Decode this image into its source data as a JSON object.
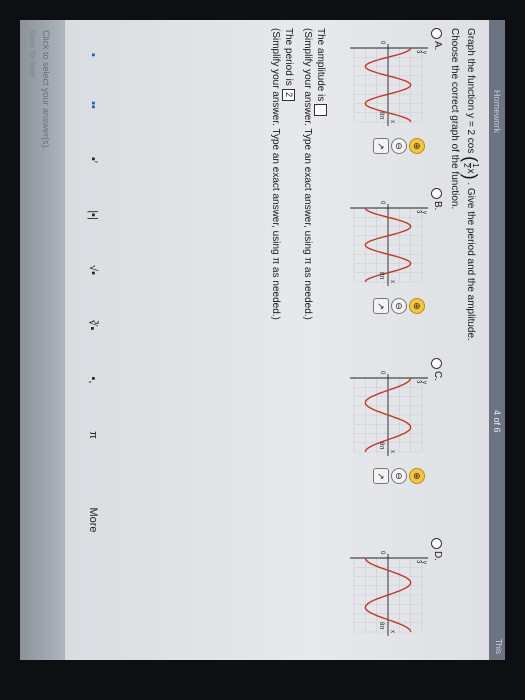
{
  "header": {
    "breadcrumb": "Homework",
    "page_indicator": "4 of 6",
    "corner": "This"
  },
  "question": {
    "prefix": "Graph the function y = 2 cos",
    "frac_num": "1",
    "frac_den": "2",
    "frac_var": "x",
    "suffix": ". Give the period and the amplitude.",
    "instruction": "Choose the correct graph of the function."
  },
  "options": [
    {
      "label": "A."
    },
    {
      "label": "B."
    },
    {
      "label": "C."
    },
    {
      "label": "D."
    }
  ],
  "graph_labels": {
    "y_top": "3",
    "y_axis": "y",
    "x_axis": "x",
    "x_tick": "8π",
    "origin": "0"
  },
  "answers": {
    "amplitude_prefix": "The amplitude is",
    "amplitude_hint": "(Simplify your answer. Type an exact answer, using π as needed.)",
    "period_prefix": "The period is",
    "period_value": "2",
    "period_hint": "(Simplify your answer. Type an exact answer, using π as needed.)"
  },
  "toolbar": [
    "▪",
    "▪▪",
    "▪′",
    "|▪|",
    "√▪",
    "∛▪",
    "▪,",
    "π",
    "More"
  ],
  "footer": {
    "hint": "Click to select your answer(s).",
    "hint2": "Save for later"
  }
}
